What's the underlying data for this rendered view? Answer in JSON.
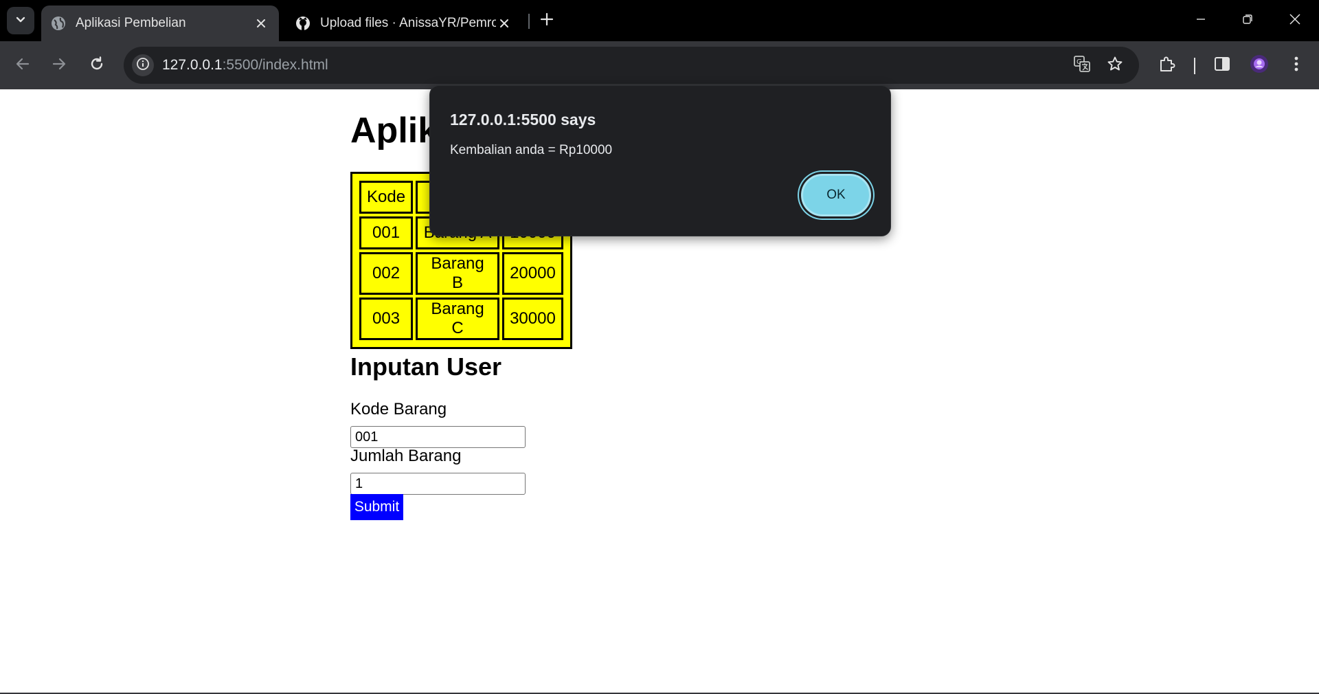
{
  "browser": {
    "tabs": [
      {
        "title": "Aplikasi Pembelian",
        "favicon": "globe-icon",
        "active": true
      },
      {
        "title": "Upload files · AnissaYR/Pemrog",
        "favicon": "github-icon",
        "active": false
      }
    ],
    "address": {
      "host": "127.0.0.1",
      "path": ":5500/index.html"
    },
    "colors": {
      "tabbar": "#000000",
      "toolbar": "#35363a",
      "omnibox": "#202124"
    }
  },
  "page": {
    "title_visible": "Aplik",
    "table": {
      "rows": [
        [
          "Kode",
          "",
          ""
        ],
        [
          "001",
          "Barang A",
          "10000"
        ],
        [
          "002",
          "Barang B",
          "20000"
        ],
        [
          "003",
          "Barang C",
          "30000"
        ]
      ],
      "background": "#ffff00"
    },
    "section_title": "Inputan User",
    "form": {
      "kode_label": "Kode Barang",
      "kode_value": "001",
      "jumlah_label": "Jumlah Barang",
      "jumlah_value": "1",
      "submit_label": "Submit",
      "submit_color": "#0000ff"
    }
  },
  "dialog": {
    "title": "127.0.0.1:5500 says",
    "message": "Kembalian anda = Rp10000",
    "ok_label": "OK",
    "ok_color": "#7cd4e8"
  }
}
